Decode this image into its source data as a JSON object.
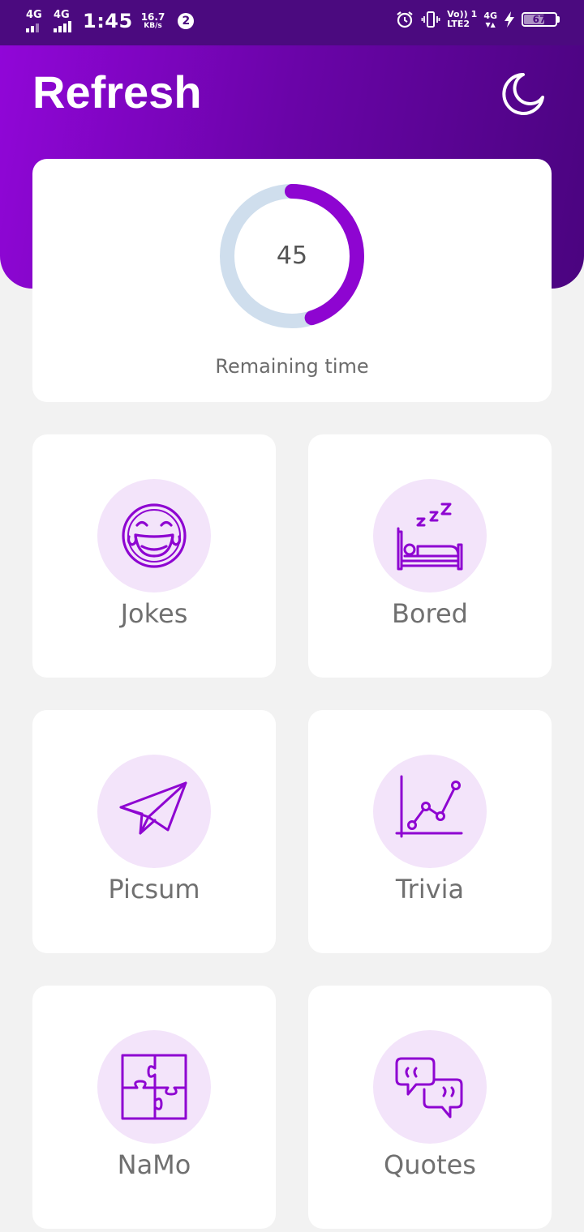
{
  "status_bar": {
    "sim1_network": "4G",
    "sim2_network": "4G",
    "time": "1:45",
    "speed_value": "16.7",
    "speed_unit": "KB/s",
    "notification_count": "2",
    "volte_top": "Vo))",
    "volte_sim": "1",
    "lte_label": "LTE2",
    "network_4g": "4G",
    "network_arrows": "▼▲",
    "battery_percent": "67"
  },
  "header": {
    "title": "Refresh",
    "accent_start": "#9106d8",
    "accent_end": "#4a047f",
    "theme_icon": "moon-icon"
  },
  "timer": {
    "value": "45",
    "label": "Remaining time",
    "progress_fraction": 0.45,
    "progress_color": "#8e05d1",
    "track_color": "#cfdeed"
  },
  "tiles": [
    {
      "label": "Jokes",
      "icon": "laughing-face-icon"
    },
    {
      "label": "Bored",
      "icon": "sleeping-bed-icon"
    },
    {
      "label": "Picsum",
      "icon": "paper-plane-icon"
    },
    {
      "label": "Trivia",
      "icon": "line-graph-icon"
    },
    {
      "label": "NaMo",
      "icon": "puzzle-icon"
    },
    {
      "label": "Quotes",
      "icon": "quote-bubbles-icon"
    }
  ],
  "icon_color": "#8e05d1",
  "icon_bg_color": "#f3e4fa"
}
